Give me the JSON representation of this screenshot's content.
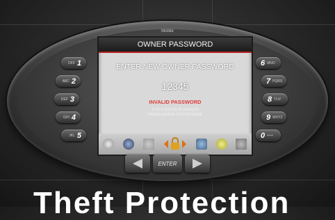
{
  "brand": "Mobile",
  "screen": {
    "title": "OWNER PASSWORD",
    "prompt": "ENTER NEW OWNER PASSWORD",
    "password_value": "12345",
    "error": "INVALID PASSWORD",
    "hint_line1": "4 TO 8 DIGITS IN LENGTH",
    "hint_line2": "PRESS ENTER TO CONTINUE"
  },
  "left_keys": [
    {
      "digit": "1",
      "sub": "OFF"
    },
    {
      "digit": "2",
      "sub": "ABC"
    },
    {
      "digit": "3",
      "sub": "DEF"
    },
    {
      "digit": "4",
      "sub": "GHI"
    },
    {
      "digit": "5",
      "sub": "JKL"
    }
  ],
  "right_keys": [
    {
      "digit": "6",
      "sub": "MNO"
    },
    {
      "digit": "7",
      "sub": "PQRS"
    },
    {
      "digit": "8",
      "sub": "TUV"
    },
    {
      "digit": "9",
      "sub": "WXYZ"
    },
    {
      "digit": "0",
      "sub": "+++"
    }
  ],
  "nav": {
    "enter_label": "ENTER"
  },
  "headline": "Theft Protection",
  "colors": {
    "title_bar": "#1b1b1b",
    "error": "#e03c3c",
    "accent": "#b52020",
    "lock_icon": "#e0a020"
  }
}
